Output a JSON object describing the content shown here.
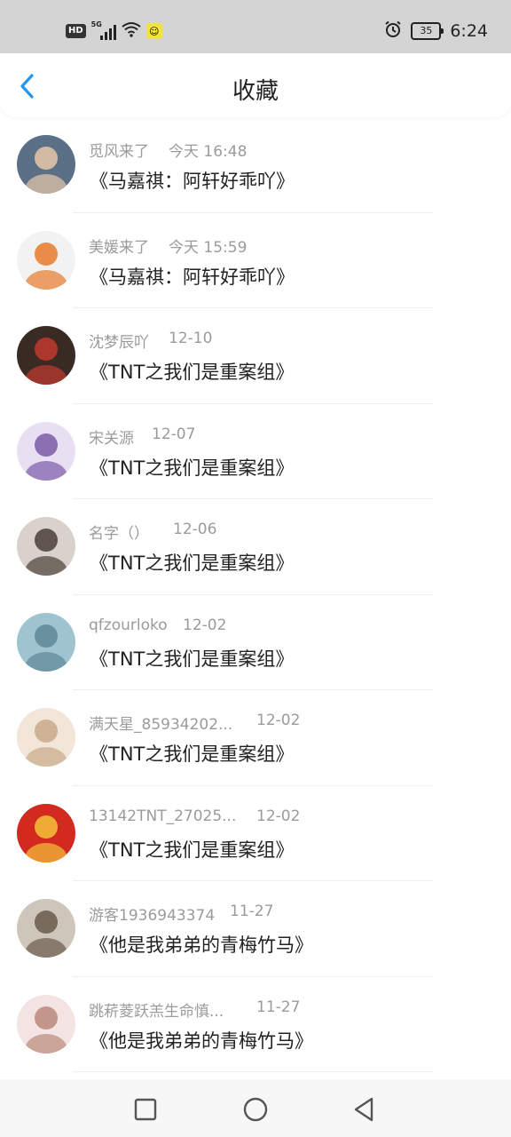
{
  "status_bar": {
    "hd_label": "HD",
    "network_label": "5G",
    "battery_level": "35",
    "time": "6:24"
  },
  "header": {
    "title": "收藏",
    "back_icon": "chevron-left-icon",
    "accent_color": "#2196f3"
  },
  "items": [
    {
      "username": "觅风来了",
      "time": "今天 16:48",
      "title": "《马嘉祺：阿轩好乖吖》",
      "avatar_colors": [
        "#5b6f86",
        "#e8c9a9"
      ]
    },
    {
      "username": "美媛来了",
      "time": "今天 15:59",
      "title": "《马嘉祺：阿轩好乖吖》",
      "avatar_colors": [
        "#f2f2f2",
        "#e87a2a"
      ]
    },
    {
      "username": "沈梦辰吖",
      "time": "12-10",
      "title": "《TNT之我们是重案组》",
      "avatar_colors": [
        "#3a2a24",
        "#c23a2e"
      ]
    },
    {
      "username": "宋关源",
      "time": "12-07",
      "title": "《TNT之我们是重案组》",
      "avatar_colors": [
        "#e9dff3",
        "#7b5aa6"
      ]
    },
    {
      "username": "名字（）",
      "time": "12-06",
      "title": "《TNT之我们是重案组》",
      "avatar_colors": [
        "#d9d2cc",
        "#4a4038"
      ]
    },
    {
      "username": "qfzourloko",
      "time": "12-02",
      "title": "《TNT之我们是重案组》",
      "avatar_colors": [
        "#9fc3cf",
        "#5e8796"
      ]
    },
    {
      "username": "满天星_85934202...",
      "time": "12-02",
      "title": "《TNT之我们是重案组》",
      "avatar_colors": [
        "#f1e6d8",
        "#c9a98a"
      ]
    },
    {
      "username": "13142TNT_27025...",
      "time": "12-02",
      "title": "《TNT之我们是重案组》",
      "avatar_colors": [
        "#d22a1e",
        "#f3c33a"
      ]
    },
    {
      "username": "游客1936943374",
      "time": "11-27",
      "title": "《他是我弟弟的青梅竹马》",
      "avatar_colors": [
        "#cfc6bb",
        "#6a5a4a"
      ]
    },
    {
      "username": "跳菥菱跃羔生命慎...",
      "time": "11-27",
      "title": "《他是我弟弟的青梅竹马》",
      "avatar_colors": [
        "#f3e3e3",
        "#b98a7a"
      ]
    }
  ],
  "nav_bar": {
    "recents_icon": "square-icon",
    "home_icon": "circle-icon",
    "back_icon": "triangle-back-icon"
  }
}
